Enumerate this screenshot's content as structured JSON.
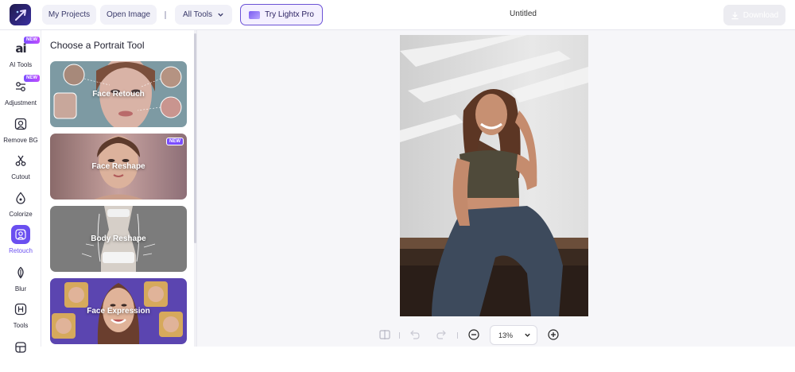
{
  "app": {
    "top": {
      "my_projects": "My Projects",
      "open_image": "Open Image",
      "all_tools": "All Tools",
      "try_pro": "Try Lightx Pro",
      "document_title": "Untitled",
      "download": "Download"
    },
    "sidebar": {
      "items": [
        {
          "label": "AI Tools",
          "icon": "ai-icon",
          "badge": "NEW"
        },
        {
          "label": "Adjustment",
          "icon": "sliders-icon",
          "badge": "NEW"
        },
        {
          "label": "Remove BG",
          "icon": "remove-bg-icon"
        },
        {
          "label": "Cutout",
          "icon": "scissors-icon"
        },
        {
          "label": "Colorize",
          "icon": "droplet-icon"
        },
        {
          "label": "Retouch",
          "icon": "retouch-icon",
          "active": true
        },
        {
          "label": "Blur",
          "icon": "leaf-icon"
        },
        {
          "label": "Tools",
          "icon": "tools-icon"
        }
      ]
    },
    "panel": {
      "title": "Choose a Portrait Tool",
      "cards": [
        {
          "label": "Face Retouch"
        },
        {
          "label": "Face Reshape",
          "badge": "NEW"
        },
        {
          "label": "Body Reshape"
        },
        {
          "label": "Face Expression"
        }
      ]
    },
    "canvas": {
      "zoom": "13%"
    }
  },
  "colors": {
    "accent": "#6a4ff0",
    "pro_border": "#6b52d6",
    "canvas_bg": "#f6f6f9"
  }
}
